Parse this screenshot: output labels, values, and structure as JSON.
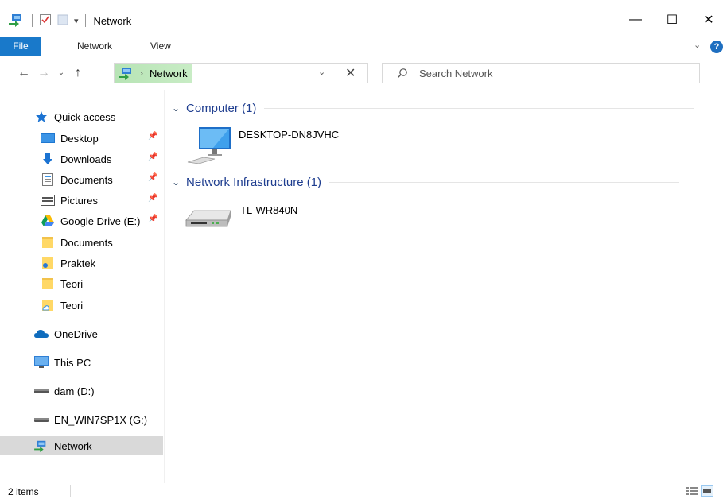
{
  "window": {
    "title": "Network",
    "minimize": "—",
    "maximize": "☐",
    "close": "✕"
  },
  "ribbon": {
    "tabs": [
      "File",
      "Network",
      "View"
    ],
    "expand": "⌄",
    "help": "?"
  },
  "nav": {
    "back": "←",
    "forward": "→",
    "recent": "⌄",
    "up": "↑"
  },
  "address": {
    "crumb_separator": "›",
    "location": "Network",
    "dropdown": "⌄",
    "clear": "✕"
  },
  "search": {
    "placeholder": "Search Network"
  },
  "navpane": {
    "quick_access": "Quick access",
    "items": [
      {
        "label": "Desktop",
        "pinned": true
      },
      {
        "label": "Downloads",
        "pinned": true
      },
      {
        "label": "Documents",
        "pinned": true
      },
      {
        "label": "Pictures",
        "pinned": true
      },
      {
        "label": "Google Drive (E:)",
        "pinned": true
      },
      {
        "label": "Documents",
        "pinned": false
      },
      {
        "label": "Praktek",
        "pinned": false
      },
      {
        "label": "Teori",
        "pinned": false
      },
      {
        "label": "Teori",
        "pinned": false
      }
    ],
    "onedrive": "OneDrive",
    "this_pc": "This PC",
    "drive_d": "dam (D:)",
    "drive_g": "EN_WIN7SP1X (G:)",
    "network": "Network"
  },
  "content": {
    "groups": [
      {
        "title": "Computer (1)",
        "items": [
          "DESKTOP-DN8JVHC"
        ]
      },
      {
        "title": "Network Infrastructure (1)",
        "items": [
          "TL-WR840N"
        ]
      }
    ],
    "group_chevron": "⌄"
  },
  "status": {
    "count": "2 items"
  },
  "colors": {
    "accent": "#1979ca",
    "group_title": "#1e3d8f",
    "selection": "#d9d9d9",
    "address_highlight": "#b7e4b5"
  }
}
